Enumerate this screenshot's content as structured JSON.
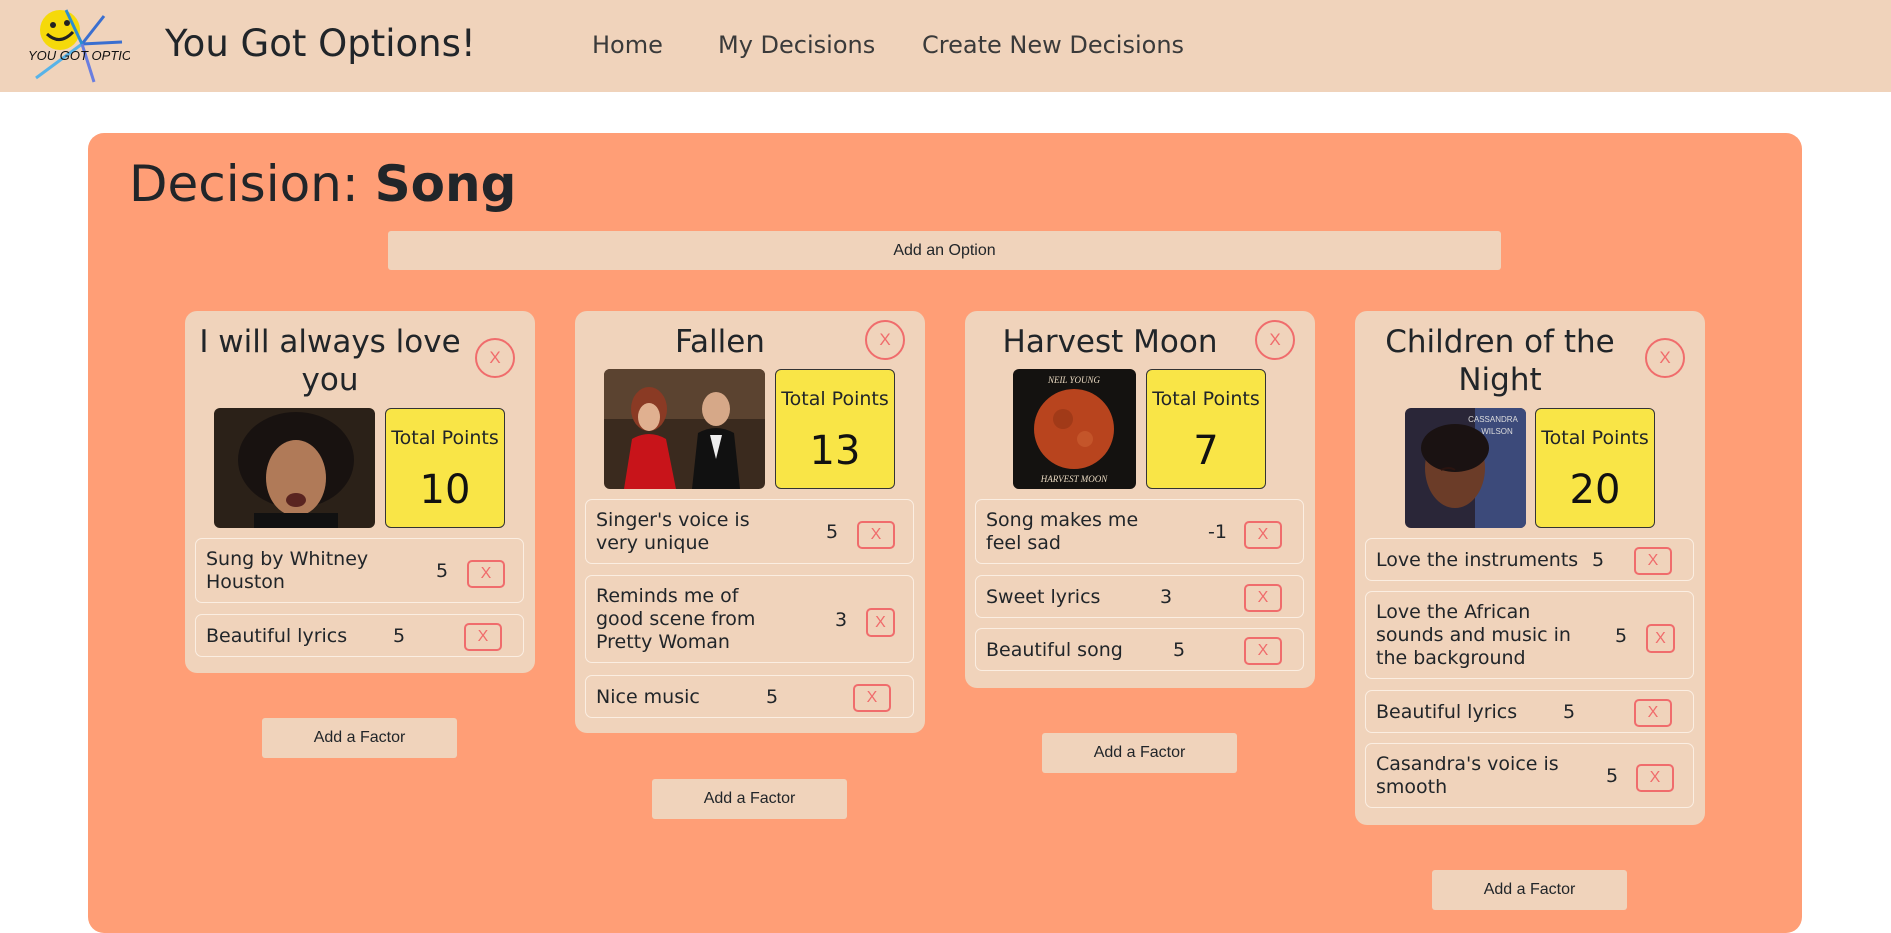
{
  "header": {
    "brand": "You Got Options!",
    "nav": [
      "Home",
      "My Decisions",
      "Create New Decisions"
    ],
    "logo_text": "YOU GOT OPTIONS!"
  },
  "decision": {
    "prefix": "Decision:",
    "name": "Song",
    "add_option_label": "Add an Option"
  },
  "total_points_label": "Total Points",
  "remove_label": "X",
  "add_factor_label": "Add a Factor",
  "options": [
    {
      "title": "I will always love you",
      "points": "10",
      "factors": [
        {
          "text": "Sung by Whitney Houston",
          "value": "5"
        },
        {
          "text": "Beautiful lyrics",
          "value": "5"
        }
      ]
    },
    {
      "title": "Fallen",
      "points": "13",
      "factors": [
        {
          "text": "Singer's voice is very unique",
          "value": "5"
        },
        {
          "text": "Reminds me of good scene from Pretty Woman",
          "value": "3"
        },
        {
          "text": "Nice music",
          "value": "5"
        }
      ]
    },
    {
      "title": "Harvest Moon",
      "points": "7",
      "album_text": [
        "NEIL YOUNG",
        "HARVEST MOON"
      ],
      "factors": [
        {
          "text": "Song makes me feel sad",
          "value": "-1"
        },
        {
          "text": "Sweet lyrics",
          "value": "3"
        },
        {
          "text": "Beautiful song",
          "value": "5"
        }
      ]
    },
    {
      "title": "Children of the Night",
      "points": "20",
      "album_text": [
        "CASSANDRA",
        "WILSON"
      ],
      "factors": [
        {
          "text": "Love the instruments",
          "value": "5"
        },
        {
          "text": "Love the African sounds and music in the background",
          "value": "5"
        },
        {
          "text": "Beautiful lyrics",
          "value": "5"
        },
        {
          "text": "Casandra's voice is smooth",
          "value": "5"
        }
      ]
    }
  ],
  "colors": {
    "navbar": "#f0d3bb",
    "panel": "#ff9e76",
    "card": "#f0d3bb",
    "points_box": "#f9e547",
    "remove_accent": "#f06c6c"
  }
}
